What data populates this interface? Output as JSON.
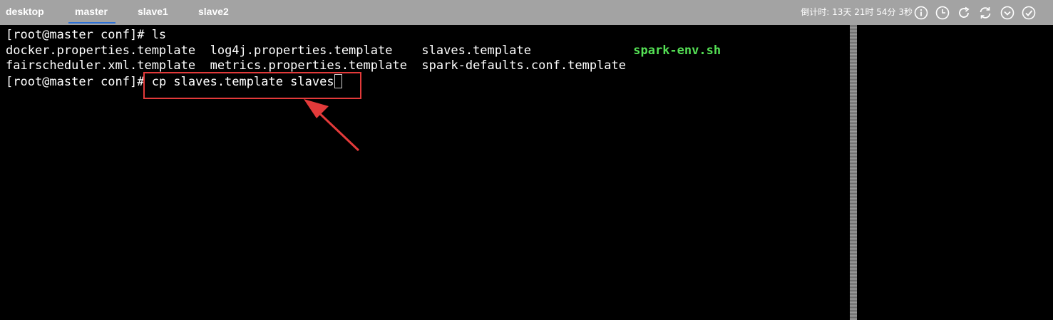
{
  "tabs": [
    {
      "label": "desktop",
      "active": false
    },
    {
      "label": "master",
      "active": true
    },
    {
      "label": "slave1",
      "active": false
    },
    {
      "label": "slave2",
      "active": false
    }
  ],
  "countdown": "倒计时: 13天 21时 54分 3秒",
  "toolbar_icons": [
    "info-icon",
    "clock-icon",
    "refresh-icon",
    "sync-icon",
    "chevron-down-circle-icon",
    "check-circle-icon"
  ],
  "terminal": {
    "line1": "[root@master conf]# ls",
    "ls_row1": {
      "c1": "docker.properties.template",
      "c2": "log4j.properties.template",
      "c3": "slaves.template",
      "c4": "spark-env.sh"
    },
    "ls_row2": {
      "c1": "fairscheduler.xml.template",
      "c2": "metrics.properties.template",
      "c3": "spark-defaults.conf.template"
    },
    "prompt": "[root@master conf]# ",
    "command": "cp slaves.template slaves"
  },
  "colors": {
    "topbar": "#a3a3a3",
    "active_underline": "#2b6fd6",
    "exec_file": "#55e155",
    "annotation": "#e33a3a"
  }
}
